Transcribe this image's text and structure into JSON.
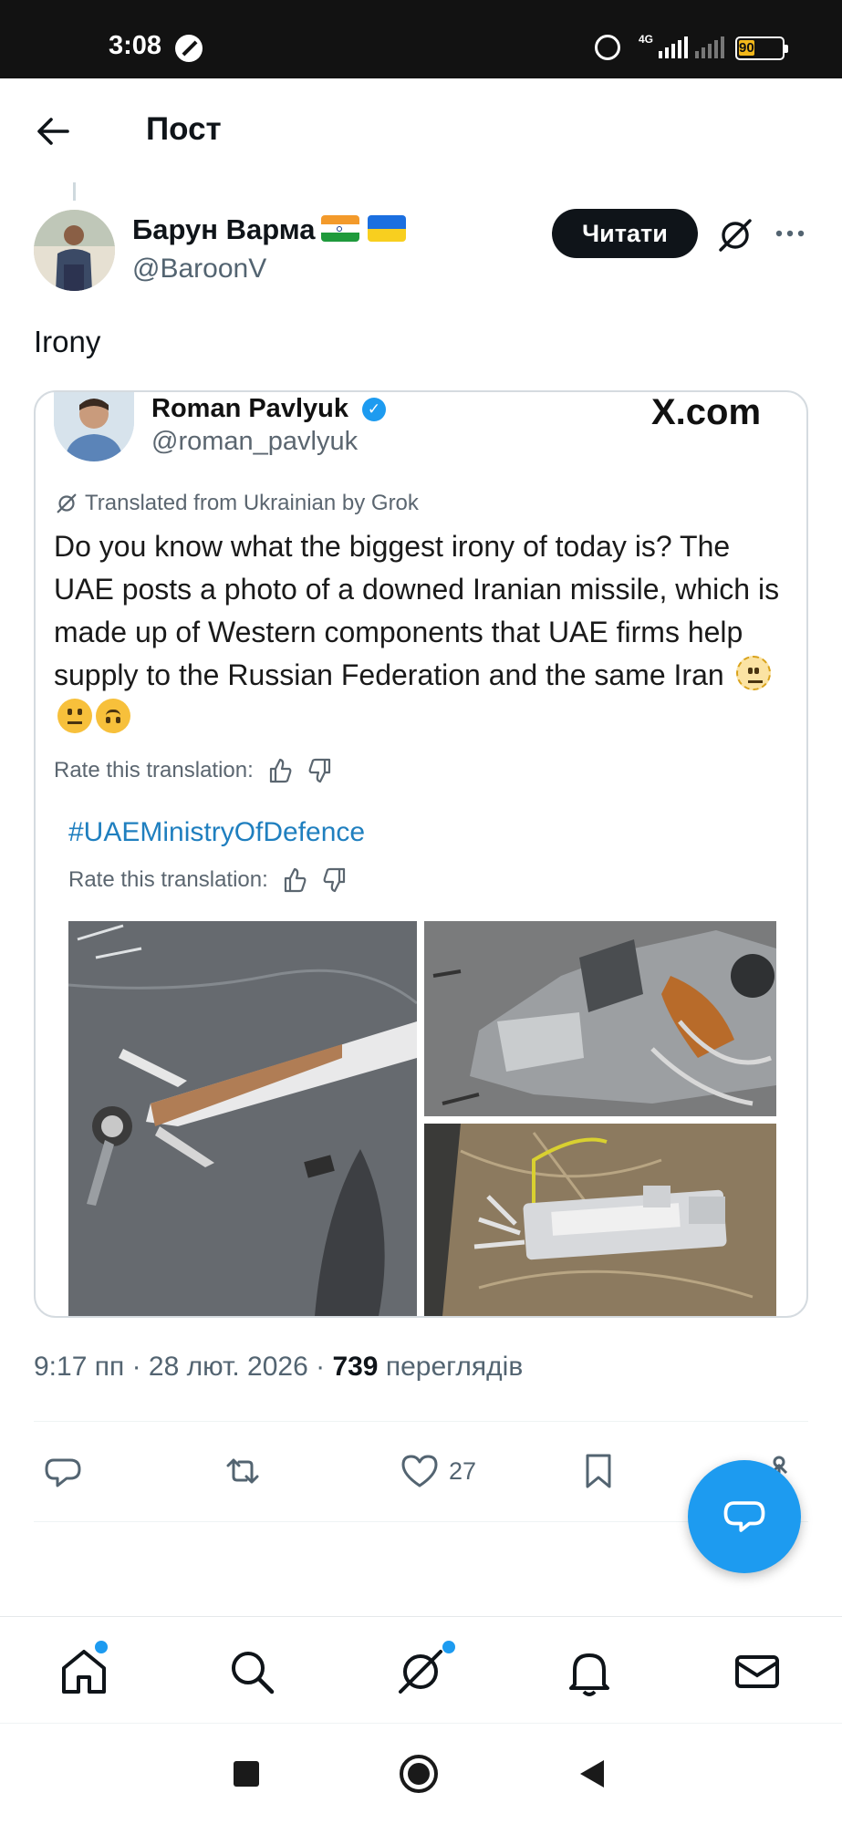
{
  "status_bar": {
    "time": "3:08",
    "network": "4G",
    "battery": "90"
  },
  "header": {
    "title": "Пост"
  },
  "author": {
    "name": "Барун Варма",
    "handle": "@BaroonV",
    "follow_label": "Читати"
  },
  "tweet": {
    "text": "Irony"
  },
  "embedded": {
    "name": "Roman Pavlyuk",
    "handle": "@roman_pavlyuk",
    "source": "X.com",
    "translated_note": "Translated from Ukrainian by Grok",
    "body": "Do you know what the biggest irony of today is? The UAE posts a photo of a downed Iranian missile, which is made up of Western components that UAE firms help supply to the Russian Federation and the same Iran",
    "rate_label": "Rate this translation:",
    "hashtag": "#UAEMinistryOfDefence"
  },
  "meta": {
    "time": "9:17 пп",
    "date": "28 лют. 2026",
    "views_count": "739",
    "views_label": "переглядів"
  },
  "actions": {
    "likes": "27"
  },
  "icons": {
    "back": "arrow-left-icon",
    "grok": "grok-icon",
    "more": "more-dots-icon",
    "reply": "reply-icon",
    "repost": "repost-icon",
    "like": "heart-icon",
    "bookmark": "bookmark-icon",
    "share": "share-icon",
    "compose": "chat-bubble-icon",
    "home": "home-icon",
    "search": "search-icon",
    "notifications": "bell-icon",
    "messages": "mail-icon"
  },
  "colors": {
    "accent": "#1d9bf0",
    "text": "#0f1419",
    "muted": "#536471"
  }
}
